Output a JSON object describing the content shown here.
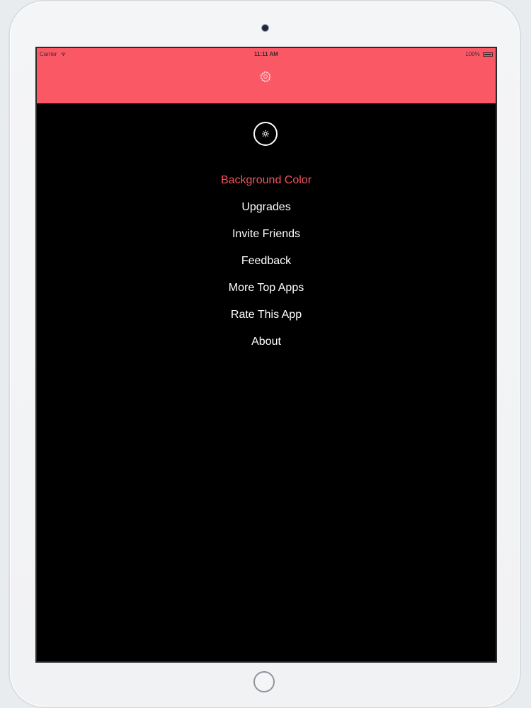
{
  "status_bar": {
    "carrier": "Carrier",
    "time": "11:11 AM",
    "battery": "100%"
  },
  "header": {
    "icon": "gear-icon",
    "color": "#fb5866"
  },
  "menu": {
    "icon": "gear-circle-icon",
    "active_color": "#f4535f",
    "items": [
      {
        "label": "Background Color"
      },
      {
        "label": "Upgrades"
      },
      {
        "label": "Invite Friends"
      },
      {
        "label": "Feedback"
      },
      {
        "label": "More Top Apps"
      },
      {
        "label": "Rate This App"
      },
      {
        "label": "About"
      }
    ]
  }
}
